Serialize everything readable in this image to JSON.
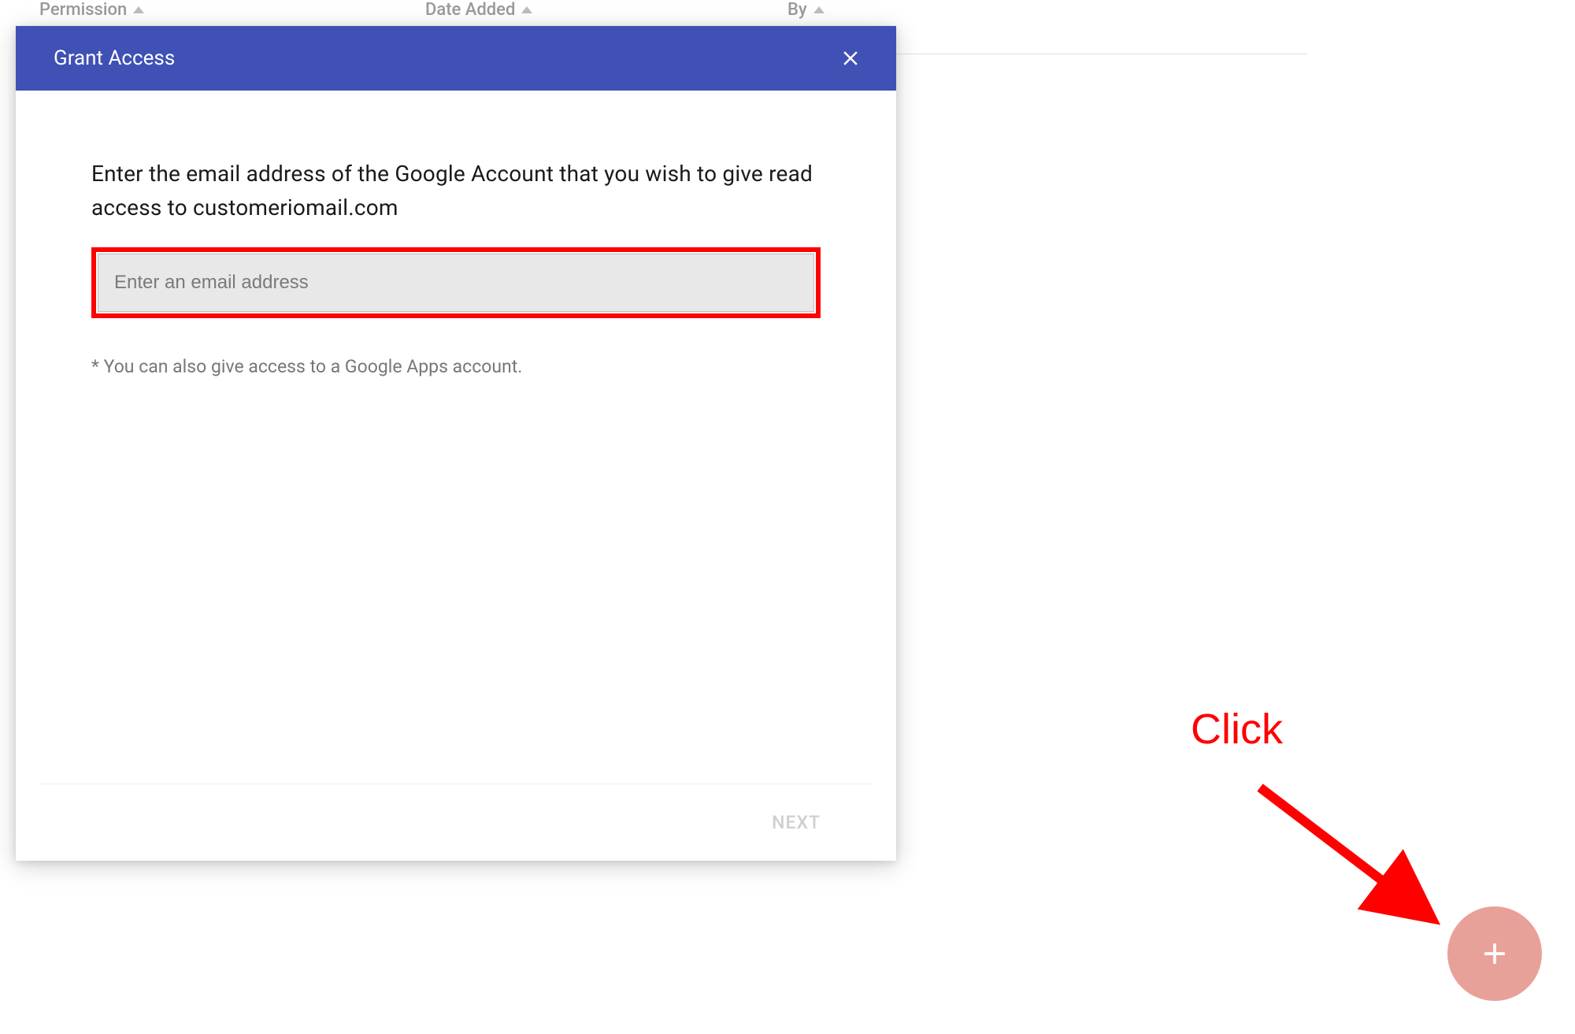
{
  "background": {
    "columns": {
      "permission": "Permission",
      "date_added": "Date Added",
      "by": "By"
    }
  },
  "modal": {
    "title": "Grant Access",
    "prompt": "Enter the email address of the Google Account that you wish to give read access to customeriomail.com",
    "email_placeholder": "Enter an email address",
    "note": "* You can also give access to a Google Apps account.",
    "next_label": "NEXT"
  },
  "annotation": {
    "click_label": "Click"
  },
  "colors": {
    "primary": "#3f51b5",
    "highlight": "#ff0000",
    "fab": "#e8a199"
  }
}
